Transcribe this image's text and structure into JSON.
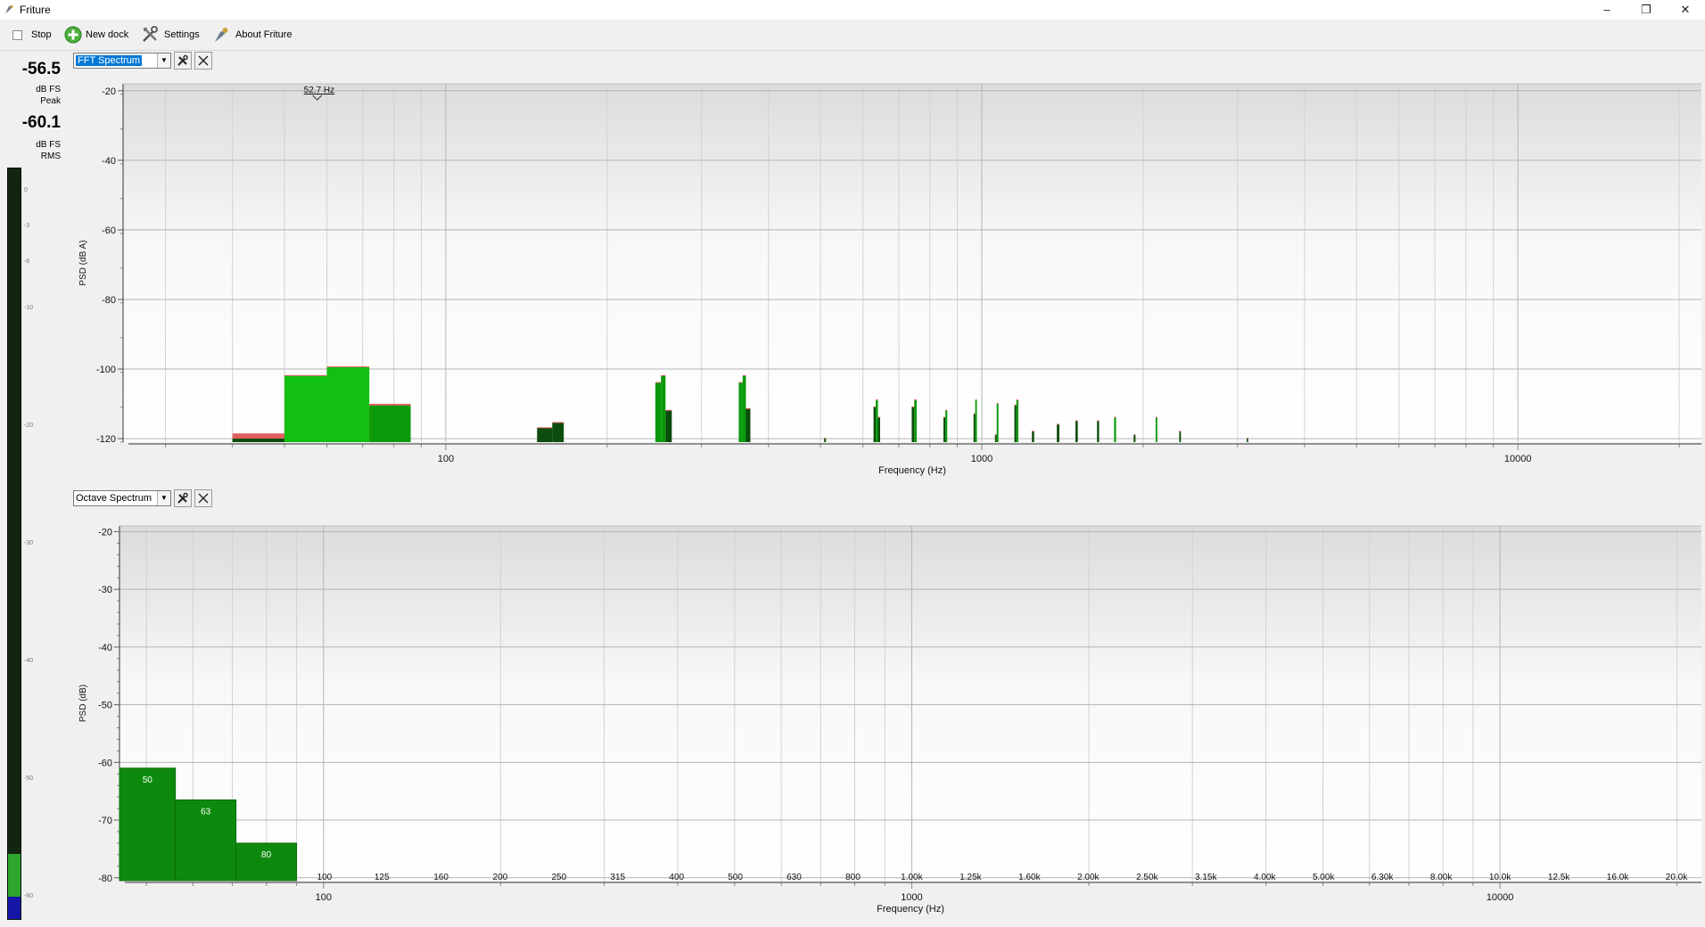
{
  "window": {
    "title": "Friture",
    "minimize": "–",
    "maximize": "❐",
    "close": "✕"
  },
  "toolbar": {
    "stop_label": "Stop",
    "new_dock_label": "New dock",
    "settings_label": "Settings",
    "about_label": "About Friture"
  },
  "levels": {
    "peak_value": "-56.5",
    "peak_unit": "dB FS",
    "peak_label": "Peak",
    "rms_value": "-60.1",
    "rms_unit": "dB FS",
    "rms_label": "RMS",
    "meter_ticks": [
      "0",
      "-3",
      "-6",
      "-10",
      "-20",
      "-30",
      "-40",
      "-50",
      "-60"
    ],
    "meter_green_level_db": -56.5,
    "meter_blue_level_db": -60.1
  },
  "docks": {
    "fft": {
      "widget_label": "FFT Spectrum",
      "cursor_readout": "52.7 Hz"
    },
    "octave": {
      "widget_label": "Octave Spectrum"
    }
  },
  "colors": {
    "bar_light": "#11c011",
    "bar_mid": "#0a9a0a",
    "bar_dark": "#0c4c0c",
    "peak_hold": "#e06060",
    "meter_bg": "#112511",
    "meter_blue": "#1515a8"
  },
  "chart_data": [
    {
      "type": "bar",
      "name": "FFT Spectrum",
      "xlabel": "Frequency (Hz)",
      "ylabel": "PSD (dB A)",
      "x_scale": "log",
      "xlim": [
        25,
        22000
      ],
      "ylim": [
        -121,
        -18
      ],
      "xticks": [
        100,
        1000,
        10000
      ],
      "yticks": [
        -20,
        -40,
        -60,
        -80,
        -100,
        -120
      ],
      "bars": [
        {
          "f0": 40,
          "f1": 50,
          "value": -120,
          "peak": -118.5,
          "shade": "dark"
        },
        {
          "f0": 50,
          "f1": 60,
          "value": -102,
          "peak": -102,
          "shade": "light"
        },
        {
          "f0": 60,
          "f1": 72,
          "value": -99.5,
          "peak": -99.5,
          "shade": "light"
        },
        {
          "f0": 72,
          "f1": 86,
          "value": -110.5,
          "peak": -110,
          "shade": "mid"
        },
        {
          "f0": 148,
          "f1": 158,
          "value": -117,
          "peak": -117,
          "shade": "dark"
        },
        {
          "f0": 158,
          "f1": 166,
          "value": -115.5,
          "peak": -115.5,
          "shade": "dark"
        },
        {
          "f0": 246,
          "f1": 252,
          "value": -104,
          "peak": -104,
          "shade": "mid"
        },
        {
          "f0": 252,
          "f1": 257,
          "value": -102,
          "peak": -102,
          "shade": "mid"
        },
        {
          "f0": 257,
          "f1": 264,
          "value": -112,
          "peak": -112,
          "shade": "dark"
        },
        {
          "f0": 352,
          "f1": 358,
          "value": -104,
          "peak": -104,
          "shade": "mid"
        },
        {
          "f0": 358,
          "f1": 363,
          "value": -102,
          "peak": -102,
          "shade": "mid"
        },
        {
          "f0": 363,
          "f1": 370,
          "value": -111.5,
          "peak": -111.5,
          "shade": "dark"
        },
        {
          "f0": 508,
          "f1": 512,
          "value": -120,
          "peak": -120,
          "shade": "dark"
        },
        {
          "f0": 628,
          "f1": 634,
          "value": -111,
          "peak": -111,
          "shade": "dark"
        },
        {
          "f0": 634,
          "f1": 640,
          "value": -109,
          "peak": -109,
          "shade": "mid"
        },
        {
          "f0": 640,
          "f1": 646,
          "value": -114,
          "peak": -114,
          "shade": "dark"
        },
        {
          "f0": 740,
          "f1": 748,
          "value": -111,
          "peak": -111,
          "shade": "dark"
        },
        {
          "f0": 748,
          "f1": 756,
          "value": -109,
          "peak": -109,
          "shade": "mid"
        },
        {
          "f0": 848,
          "f1": 855,
          "value": -114,
          "peak": -114,
          "shade": "dark"
        },
        {
          "f0": 855,
          "f1": 862,
          "value": -112,
          "peak": -112,
          "shade": "mid"
        },
        {
          "f0": 965,
          "f1": 972,
          "value": -113,
          "peak": -113,
          "shade": "dark"
        },
        {
          "f0": 972,
          "f1": 979,
          "value": -109,
          "peak": -109,
          "shade": "mid"
        },
        {
          "f0": 1058,
          "f1": 1066,
          "value": -119,
          "peak": -119,
          "shade": "dark"
        },
        {
          "f0": 1066,
          "f1": 1074,
          "value": -110,
          "peak": -110,
          "shade": "mid"
        },
        {
          "f0": 1150,
          "f1": 1160,
          "value": -110.5,
          "peak": -110.5,
          "shade": "dark"
        },
        {
          "f0": 1160,
          "f1": 1170,
          "value": -109,
          "peak": -109,
          "shade": "mid"
        },
        {
          "f0": 1240,
          "f1": 1252,
          "value": -118,
          "peak": -118,
          "shade": "dark"
        },
        {
          "f0": 1380,
          "f1": 1395,
          "value": -116,
          "peak": -116,
          "shade": "dark"
        },
        {
          "f0": 1495,
          "f1": 1510,
          "value": -115,
          "peak": -115,
          "shade": "dark"
        },
        {
          "f0": 1640,
          "f1": 1655,
          "value": -115,
          "peak": -115,
          "shade": "dark"
        },
        {
          "f0": 1765,
          "f1": 1780,
          "value": -114,
          "peak": -114,
          "shade": "mid"
        },
        {
          "f0": 1920,
          "f1": 1935,
          "value": -119,
          "peak": -119,
          "shade": "dark"
        },
        {
          "f0": 2110,
          "f1": 2125,
          "value": -114,
          "peak": -114,
          "shade": "mid"
        },
        {
          "f0": 2335,
          "f1": 2352,
          "value": -118,
          "peak": -118,
          "shade": "dark"
        },
        {
          "f0": 3120,
          "f1": 3140,
          "value": -120,
          "peak": -120,
          "shade": "dark"
        }
      ]
    },
    {
      "type": "bar",
      "name": "Octave Spectrum",
      "xlabel": "Frequency (Hz)",
      "ylabel": "PSD (dB)",
      "x_scale": "log",
      "xlim": [
        45,
        22000
      ],
      "ylim": [
        -80.5,
        -19
      ],
      "xticks": [
        100,
        1000,
        10000
      ],
      "yticks": [
        -20,
        -30,
        -40,
        -50,
        -60,
        -70,
        -80
      ],
      "bands": [
        {
          "label": "50",
          "f0": 45,
          "f1": 56,
          "value": -61
        },
        {
          "label": "63",
          "f0": 56,
          "f1": 71,
          "value": -66.5
        },
        {
          "label": "80",
          "f0": 71,
          "f1": 90,
          "value": -74
        },
        {
          "label": "100",
          "f0": 90,
          "f1": 112,
          "value": null
        },
        {
          "label": "125",
          "f0": 112,
          "f1": 141,
          "value": null
        },
        {
          "label": "160",
          "f0": 141,
          "f1": 178,
          "value": null
        },
        {
          "label": "200",
          "f0": 178,
          "f1": 224,
          "value": null
        },
        {
          "label": "250",
          "f0": 224,
          "f1": 282,
          "value": null
        },
        {
          "label": "315",
          "f0": 282,
          "f1": 355,
          "value": null
        },
        {
          "label": "400",
          "f0": 355,
          "f1": 447,
          "value": null
        },
        {
          "label": "500",
          "f0": 447,
          "f1": 562,
          "value": null
        },
        {
          "label": "630",
          "f0": 562,
          "f1": 708,
          "value": null
        },
        {
          "label": "800",
          "f0": 708,
          "f1": 891,
          "value": null
        },
        {
          "label": "1.00k",
          "f0": 891,
          "f1": 1122,
          "value": null
        },
        {
          "label": "1.25k",
          "f0": 1122,
          "f1": 1413,
          "value": null
        },
        {
          "label": "1.60k",
          "f0": 1413,
          "f1": 1778,
          "value": null
        },
        {
          "label": "2.00k",
          "f0": 1778,
          "f1": 2239,
          "value": null
        },
        {
          "label": "2.50k",
          "f0": 2239,
          "f1": 2818,
          "value": null
        },
        {
          "label": "3.15k",
          "f0": 2818,
          "f1": 3548,
          "value": null
        },
        {
          "label": "4.00k",
          "f0": 3548,
          "f1": 4467,
          "value": null
        },
        {
          "label": "5.00k",
          "f0": 4467,
          "f1": 5623,
          "value": null
        },
        {
          "label": "6.30k",
          "f0": 5623,
          "f1": 7079,
          "value": null
        },
        {
          "label": "8.00k",
          "f0": 7079,
          "f1": 8913,
          "value": null
        },
        {
          "label": "10.0k",
          "f0": 8913,
          "f1": 11220,
          "value": null
        },
        {
          "label": "12.5k",
          "f0": 11220,
          "f1": 14125,
          "value": null
        },
        {
          "label": "16.0k",
          "f0": 14125,
          "f1": 17783,
          "value": null
        },
        {
          "label": "20.0k",
          "f0": 17783,
          "f1": 22387,
          "value": null
        }
      ]
    }
  ]
}
